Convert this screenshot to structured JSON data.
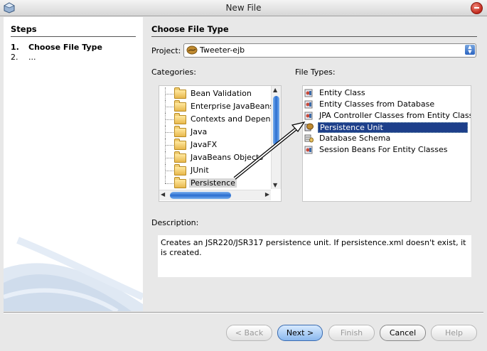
{
  "window": {
    "title": "New File"
  },
  "steps": {
    "heading": "Steps",
    "items": [
      {
        "num": "1.",
        "label": "Choose File Type"
      },
      {
        "num": "2.",
        "label": "..."
      }
    ]
  },
  "main": {
    "heading": "Choose File Type",
    "project_label": "Project:",
    "project_value": "Tweeter-ejb",
    "categories_label": "Categories:",
    "file_types_label": "File Types:",
    "categories": [
      {
        "label": "Bean Validation"
      },
      {
        "label": "Enterprise JavaBeans"
      },
      {
        "label": "Contexts and Dependency Injection"
      },
      {
        "label": "Java"
      },
      {
        "label": "JavaFX"
      },
      {
        "label": "JavaBeans Objects"
      },
      {
        "label": "JUnit"
      },
      {
        "label": "Persistence"
      }
    ],
    "file_types": [
      {
        "label": "Entity Class"
      },
      {
        "label": "Entity Classes from Database"
      },
      {
        "label": "JPA Controller Classes from Entity Classes"
      },
      {
        "label": "Persistence Unit"
      },
      {
        "label": "Database Schema"
      },
      {
        "label": "Session Beans For Entity Classes"
      }
    ],
    "description_label": "Description:",
    "description_text": "Creates an JSR220/JSR317 persistence unit. If persistence.xml doesn't exist, it is created."
  },
  "buttons": {
    "back": "< Back",
    "next": "Next >",
    "finish": "Finish",
    "cancel": "Cancel",
    "help": "Help"
  },
  "colors": {
    "selection": "#1d3f8a",
    "accent": "#2a6ed0"
  }
}
